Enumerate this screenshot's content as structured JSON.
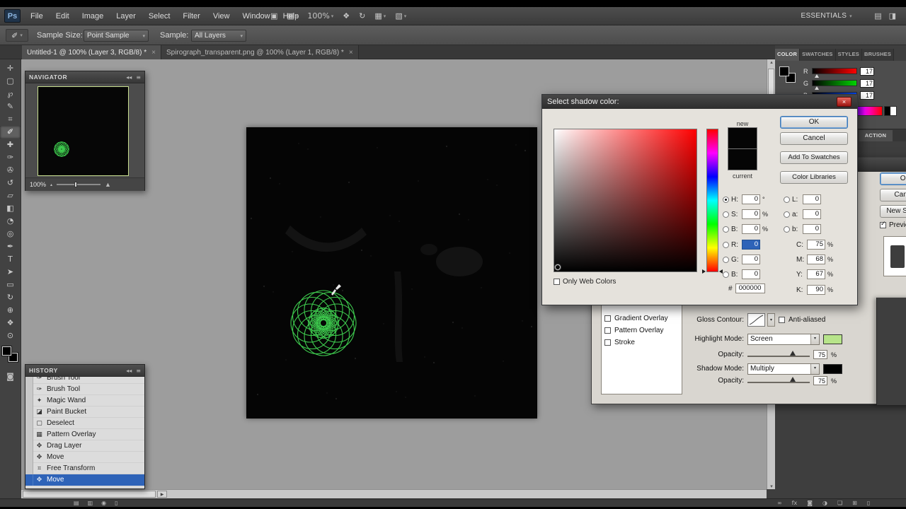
{
  "icons": {
    "collapse_double_arrow": "◂◂",
    "panel_menu": "≡",
    "close": "×",
    "chevron_down": "▾",
    "check": "✓",
    "mountain_small": "▴",
    "mountain_large": "▲",
    "scroll_right": "▶",
    "scroll_up": "▴",
    "scroll_down": "▾",
    "quick_mask": "◙"
  },
  "accent_colors": {
    "selection_blue": "#2e63b8",
    "spirograph_green": "#3ecb4e",
    "highlight_swatch_green": "#b7e48a",
    "shadow_swatch_black": "#000000"
  },
  "menu": {
    "logo": "Ps",
    "items": [
      "File",
      "Edit",
      "Image",
      "Layer",
      "Select",
      "Filter",
      "View",
      "Window",
      "Help"
    ],
    "app_icons": [
      {
        "name": "bridge-icon",
        "glyph": "▣"
      },
      {
        "name": "view-extras-icon",
        "glyph": "▦",
        "chevron": true
      },
      {
        "name": "zoom-level",
        "glyph": "100%",
        "chevron": true
      },
      {
        "name": "hand-tool-icon",
        "glyph": "❖"
      },
      {
        "name": "rotate-view-icon",
        "glyph": "↻"
      },
      {
        "name": "arrange-documents-icon",
        "glyph": "▦",
        "chevron": true
      },
      {
        "name": "screen-mode-icon",
        "glyph": "▧",
        "chevron": true
      }
    ],
    "workspace": "ESSENTIALS",
    "right_icons": [
      {
        "name": "cs-live-icon",
        "glyph": "▤"
      },
      {
        "name": "panels-icon",
        "glyph": "◨"
      }
    ]
  },
  "options_bar": {
    "tool_glyph": "✐",
    "sample_size_label": "Sample Size:",
    "sample_size_value": "Point Sample",
    "sample_label": "Sample:",
    "sample_value": "All Layers"
  },
  "document_tabs": [
    "Untitled-1 @ 100% (Layer 3, RGB/8) *",
    "Spirograph_transparent.png @ 100% (Layer 1, RGB/8) *"
  ],
  "tools": [
    {
      "name": "move-tool",
      "glyph": "✛"
    },
    {
      "name": "marquee-tool",
      "glyph": "▢"
    },
    {
      "name": "lasso-tool",
      "glyph": "℘"
    },
    {
      "name": "quick-selection-tool",
      "glyph": "✎"
    },
    {
      "name": "crop-tool",
      "glyph": "⌗"
    },
    {
      "name": "eyedropper-tool",
      "glyph": "✐",
      "active": true
    },
    {
      "name": "healing-brush-tool",
      "glyph": "✚"
    },
    {
      "name": "brush-tool",
      "glyph": "✑"
    },
    {
      "name": "clone-stamp-tool",
      "glyph": "✇"
    },
    {
      "name": "history-brush-tool",
      "glyph": "↺"
    },
    {
      "name": "eraser-tool",
      "glyph": "▱"
    },
    {
      "name": "gradient-tool",
      "glyph": "◧"
    },
    {
      "name": "blur-tool",
      "glyph": "◔"
    },
    {
      "name": "dodge-tool",
      "glyph": "◎"
    },
    {
      "name": "pen-tool",
      "glyph": "✒"
    },
    {
      "name": "type-tool",
      "glyph": "T"
    },
    {
      "name": "path-selection-tool",
      "glyph": "➤"
    },
    {
      "name": "shape-tool",
      "glyph": "▭"
    },
    {
      "name": "rotate-3d-tool",
      "glyph": "↻"
    },
    {
      "name": "orbit-3d-tool",
      "glyph": "⊕"
    },
    {
      "name": "hand-tool",
      "glyph": "❖"
    },
    {
      "name": "zoom-tool",
      "glyph": "⊙"
    }
  ],
  "navigator": {
    "title": "NAVIGATOR",
    "zoom": "100%"
  },
  "history": {
    "title": "HISTORY",
    "items": [
      {
        "label": "Brush Tool",
        "icon": "brush-icon",
        "glyph": "✑"
      },
      {
        "label": "Brush Tool",
        "icon": "brush-icon",
        "glyph": "✑"
      },
      {
        "label": "Magic Wand",
        "icon": "magic-wand-icon",
        "glyph": "✦"
      },
      {
        "label": "Paint Bucket",
        "icon": "paint-bucket-icon",
        "glyph": "◪"
      },
      {
        "label": "Deselect",
        "icon": "deselect-icon",
        "glyph": "▢"
      },
      {
        "label": "Pattern Overlay",
        "icon": "pattern-overlay-icon",
        "glyph": "▦"
      },
      {
        "label": "Drag Layer",
        "icon": "drag-layer-icon",
        "glyph": "✥"
      },
      {
        "label": "Move",
        "icon": "move-icon",
        "glyph": "✥"
      },
      {
        "label": "Free Transform",
        "icon": "free-transform-icon",
        "glyph": "⌗"
      },
      {
        "label": "Move",
        "icon": "move-icon",
        "glyph": "✥",
        "selected": true
      }
    ]
  },
  "color_panel": {
    "tabs": [
      "COLOR",
      "SWATCHES",
      "STYLES",
      "BRUSHES"
    ],
    "channels": [
      {
        "label": "R",
        "value": "17",
        "color": "#ff0000"
      },
      {
        "label": "G",
        "value": "17",
        "color": "#00d400"
      },
      {
        "label": "B",
        "value": "17",
        "color": "#0048ff"
      }
    ]
  },
  "actions_panel_tab": "ACTION",
  "layer_style": {
    "styles_list": [
      "Gradient Overlay",
      "Pattern Overlay",
      "Stroke"
    ],
    "gloss_contour_label": "Gloss Contour:",
    "anti_aliased_label": "Anti-aliased",
    "highlight_mode_label": "Highlight Mode:",
    "highlight_mode_value": "Screen",
    "opacity_label": "Opacity:",
    "highlight_opacity": "75",
    "shadow_mode_label": "Shadow Mode:",
    "shadow_mode_value": "Multiply",
    "shadow_opacity": "75",
    "percent": "%",
    "ok_label": "OK",
    "cancel_label": "Cancel",
    "new_style_label": "New Style...",
    "preview_label": "Preview"
  },
  "color_picker": {
    "title": "Select shadow color:",
    "new_label": "new",
    "current_label": "current",
    "ok_label": "OK",
    "cancel_label": "Cancel",
    "add_to_swatches_label": "Add To Swatches",
    "color_libraries_label": "Color Libraries",
    "hsb": [
      {
        "label": "H:",
        "value": "0",
        "unit": "°",
        "radio": true
      },
      {
        "label": "S:",
        "value": "0",
        "unit": "%"
      },
      {
        "label": "B:",
        "value": "0",
        "unit": "%"
      }
    ],
    "rgb": [
      {
        "label": "R:",
        "value": "0",
        "selected": true
      },
      {
        "label": "G:",
        "value": "0"
      },
      {
        "label": "B:",
        "value": "0"
      }
    ],
    "lab": [
      {
        "label": "L:",
        "value": "0"
      },
      {
        "label": "a:",
        "value": "0"
      },
      {
        "label": "b:",
        "value": "0"
      }
    ],
    "cmyk": [
      {
        "label": "C:",
        "value": "75",
        "unit": "%"
      },
      {
        "label": "M:",
        "value": "68",
        "unit": "%"
      },
      {
        "label": "Y:",
        "value": "67",
        "unit": "%"
      },
      {
        "label": "K:",
        "value": "90",
        "unit": "%"
      }
    ],
    "hex_prefix": "#",
    "hex_value": "000000",
    "only_web_label": "Only Web Colors"
  },
  "bottom_bar": {
    "left_icons": [
      {
        "name": "new-document-icon",
        "glyph": "▤"
      },
      {
        "name": "duplicate-icon",
        "glyph": "▥"
      },
      {
        "name": "snapshot-icon",
        "glyph": "◉"
      },
      {
        "name": "delete-icon",
        "glyph": "▯"
      }
    ],
    "right_icons": [
      {
        "name": "link-layers-icon",
        "glyph": "∞"
      },
      {
        "name": "layer-style-icon",
        "glyph": "fx"
      },
      {
        "name": "layer-mask-icon",
        "glyph": "◙"
      },
      {
        "name": "adjustment-layer-icon",
        "glyph": "◑"
      },
      {
        "name": "layer-group-icon",
        "glyph": "❏"
      },
      {
        "name": "new-layer-icon",
        "glyph": "⊞"
      },
      {
        "name": "delete-layer-icon",
        "glyph": "▯"
      }
    ]
  }
}
